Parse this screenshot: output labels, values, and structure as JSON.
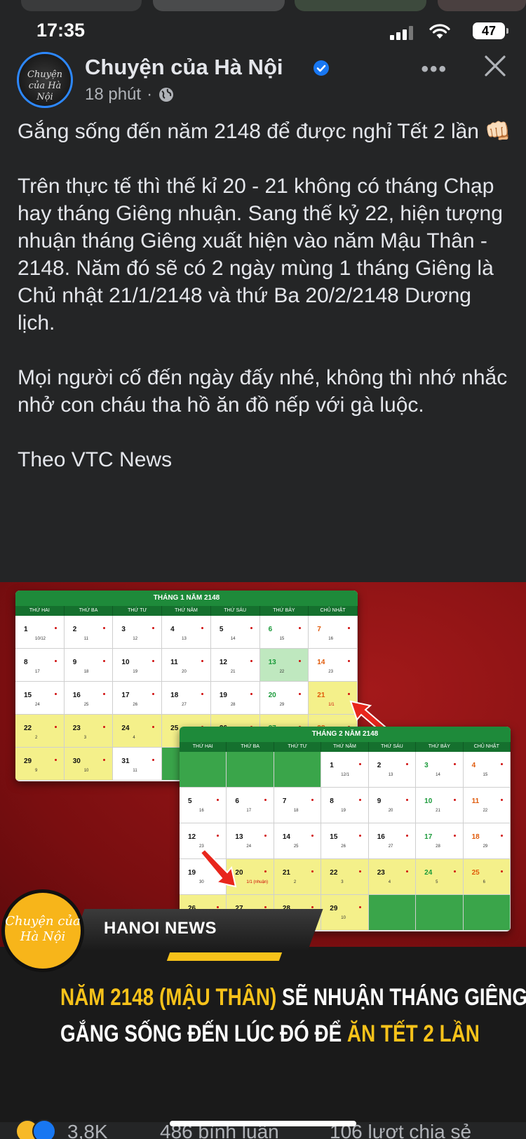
{
  "status_bar": {
    "time": "17:35",
    "battery": "47"
  },
  "post": {
    "page_name": "Chuyện của Hà Nội",
    "time_ago": "18 phút",
    "separator": "·",
    "avatar_text": "Chuyện của Hà Nội",
    "text": "Gắng sống đến năm 2148 để được nghỉ Tết 2 lần 👊🏻\n\nTrên thực tế thì thế kỉ 20 - 21 không có tháng Chạp hay tháng Giêng nhuận. Sang thế kỷ 22, hiện tượng nhuận tháng Giêng xuất hiện vào năm Mậu Thân - 2148. Năm đó sẽ có 2 ngày mùng 1 tháng Giêng là Chủ nhật 21/1/2148 và thứ Ba 20/2/2148 Dương lịch.\n\nMọi người cố đến ngày đấy nhé, không thì nhớ nhắc nhở con cháu tha hồ ăn đồ nếp với gà luộc.\n\nTheo VTC News"
  },
  "calendar1": {
    "title": "THÁNG 1 NĂM 2148",
    "weekdays": [
      "THỨ HAI",
      "THỨ BA",
      "THỨ TƯ",
      "THỨ NĂM",
      "THỨ SÁU",
      "THỨ BẢY",
      "CHỦ NHẬT"
    ],
    "cells": [
      {
        "d": "1",
        "l": "10/12",
        "c": "w"
      },
      {
        "d": "2",
        "l": "11",
        "c": "w"
      },
      {
        "d": "3",
        "l": "12",
        "c": "w"
      },
      {
        "d": "4",
        "l": "13",
        "c": "w"
      },
      {
        "d": "5",
        "l": "14",
        "c": "w"
      },
      {
        "d": "6",
        "l": "15",
        "c": "w",
        "k": "sat"
      },
      {
        "d": "7",
        "l": "16",
        "c": "w",
        "k": "sun"
      },
      {
        "d": "8",
        "l": "17",
        "c": "w"
      },
      {
        "d": "9",
        "l": "18",
        "c": "w"
      },
      {
        "d": "10",
        "l": "19",
        "c": "w"
      },
      {
        "d": "11",
        "l": "20",
        "c": "w"
      },
      {
        "d": "12",
        "l": "21",
        "c": "w"
      },
      {
        "d": "13",
        "l": "22",
        "c": "g",
        "k": "sat"
      },
      {
        "d": "14",
        "l": "23",
        "c": "w",
        "k": "sun"
      },
      {
        "d": "15",
        "l": "24",
        "c": "w"
      },
      {
        "d": "16",
        "l": "25",
        "c": "w"
      },
      {
        "d": "17",
        "l": "26",
        "c": "w"
      },
      {
        "d": "18",
        "l": "27",
        "c": "w"
      },
      {
        "d": "19",
        "l": "28",
        "c": "w"
      },
      {
        "d": "20",
        "l": "29",
        "c": "w",
        "k": "sat"
      },
      {
        "d": "21",
        "l": "1/1",
        "c": "y",
        "k": "sun",
        "lr": true
      },
      {
        "d": "22",
        "l": "2",
        "c": "y"
      },
      {
        "d": "23",
        "l": "3",
        "c": "y"
      },
      {
        "d": "24",
        "l": "4",
        "c": "y"
      },
      {
        "d": "25",
        "l": "5",
        "c": "y"
      },
      {
        "d": "26",
        "l": "6",
        "c": "y"
      },
      {
        "d": "27",
        "l": "7",
        "c": "y",
        "k": "sat"
      },
      {
        "d": "28",
        "l": "8",
        "c": "y",
        "k": "sun"
      },
      {
        "d": "29",
        "l": "9",
        "c": "y"
      },
      {
        "d": "30",
        "l": "10",
        "c": "y"
      },
      {
        "d": "31",
        "l": "11",
        "c": "w"
      },
      {
        "d": "",
        "l": "",
        "c": "e"
      },
      {
        "d": "",
        "l": "",
        "c": "e"
      },
      {
        "d": "",
        "l": "",
        "c": "e"
      },
      {
        "d": "",
        "l": "",
        "c": "e"
      }
    ]
  },
  "calendar2": {
    "title": "THÁNG 2 NĂM 2148",
    "weekdays": [
      "THỨ HAI",
      "THỨ BA",
      "THỨ TƯ",
      "THỨ NĂM",
      "THỨ SÁU",
      "THỨ BẢY",
      "CHỦ NHẬT"
    ],
    "cells": [
      {
        "d": "",
        "l": "",
        "c": "e"
      },
      {
        "d": "",
        "l": "",
        "c": "e"
      },
      {
        "d": "",
        "l": "",
        "c": "e"
      },
      {
        "d": "1",
        "l": "12/1",
        "c": "w"
      },
      {
        "d": "2",
        "l": "13",
        "c": "w"
      },
      {
        "d": "3",
        "l": "14",
        "c": "w",
        "k": "sat"
      },
      {
        "d": "4",
        "l": "15",
        "c": "w",
        "k": "sun"
      },
      {
        "d": "5",
        "l": "16",
        "c": "w"
      },
      {
        "d": "6",
        "l": "17",
        "c": "w"
      },
      {
        "d": "7",
        "l": "18",
        "c": "w"
      },
      {
        "d": "8",
        "l": "19",
        "c": "w"
      },
      {
        "d": "9",
        "l": "20",
        "c": "w"
      },
      {
        "d": "10",
        "l": "21",
        "c": "w",
        "k": "sat"
      },
      {
        "d": "11",
        "l": "22",
        "c": "w",
        "k": "sun"
      },
      {
        "d": "12",
        "l": "23",
        "c": "w"
      },
      {
        "d": "13",
        "l": "24",
        "c": "w"
      },
      {
        "d": "14",
        "l": "25",
        "c": "w"
      },
      {
        "d": "15",
        "l": "26",
        "c": "w"
      },
      {
        "d": "16",
        "l": "27",
        "c": "w"
      },
      {
        "d": "17",
        "l": "28",
        "c": "w",
        "k": "sat"
      },
      {
        "d": "18",
        "l": "29",
        "c": "w",
        "k": "sun"
      },
      {
        "d": "19",
        "l": "30",
        "c": "w"
      },
      {
        "d": "20",
        "l": "1/1 (nhuận)",
        "c": "y",
        "lr": true
      },
      {
        "d": "21",
        "l": "2",
        "c": "y"
      },
      {
        "d": "22",
        "l": "3",
        "c": "y"
      },
      {
        "d": "23",
        "l": "4",
        "c": "y"
      },
      {
        "d": "24",
        "l": "5",
        "c": "y",
        "k": "sat"
      },
      {
        "d": "25",
        "l": "6",
        "c": "y",
        "k": "sun"
      },
      {
        "d": "26",
        "l": "7",
        "c": "y"
      },
      {
        "d": "27",
        "l": "8",
        "c": "y"
      },
      {
        "d": "28",
        "l": "9",
        "c": "y"
      },
      {
        "d": "29",
        "l": "10",
        "c": "y"
      },
      {
        "d": "",
        "l": "",
        "c": "e"
      },
      {
        "d": "",
        "l": "",
        "c": "e"
      },
      {
        "d": "",
        "l": "",
        "c": "e"
      }
    ]
  },
  "banner": {
    "logo_text": "Chuyện của Hà Nội",
    "label": "HANOI NEWS"
  },
  "headline": {
    "line1_a": "NĂM 2148 ",
    "line1_b": "(MẬU THÂN)",
    "line1_c": " SẼ NHUẬN THÁNG GIÊNG",
    "line2_a": "GẮNG SỐNG ĐẾN LÚC ĐÓ ĐỂ ",
    "line2_b": "ĂN TẾT 2 LẦN"
  },
  "footer": {
    "reactions_count": "3,8K",
    "comments": "486 bình luận",
    "shares": "106 lượt chia sẻ"
  },
  "colors": {
    "background": "#242526",
    "accent_blue": "#2d88ff",
    "calendar_green": "#1e8a3a",
    "highlight_yellow": "#f7c21a"
  }
}
